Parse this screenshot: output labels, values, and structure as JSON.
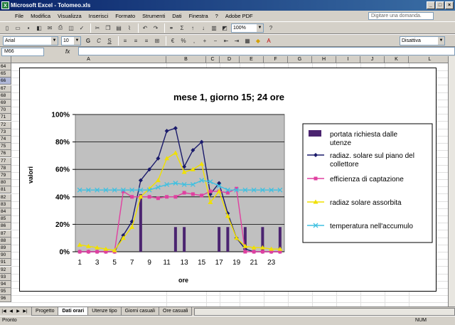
{
  "window": {
    "title": "Microsoft Excel - Tolomeo.xls",
    "app_icon": "X"
  },
  "menu": [
    "File",
    "Modifica",
    "Visualizza",
    "Inserisci",
    "Formato",
    "Strumenti",
    "Dati",
    "Finestra",
    "?",
    "Adobe PDF"
  ],
  "ask_placeholder": "Digitare una domanda.",
  "toolbar": {
    "zoom": "100%",
    "font": "Arial",
    "size": "10",
    "style": "Disattiva"
  },
  "formula": {
    "namebox": "M66",
    "fx": "fx"
  },
  "columns": [
    "A",
    "B",
    "C",
    "D",
    "E",
    "F",
    "G",
    "H",
    "I",
    "J",
    "K",
    "L"
  ],
  "rows": [
    "64",
    "65",
    "66",
    "67",
    "68",
    "69",
    "70",
    "71",
    "72",
    "73",
    "74",
    "75",
    "76",
    "77",
    "78",
    "79",
    "80",
    "81",
    "82",
    "83",
    "84",
    "85",
    "86",
    "87",
    "88",
    "89",
    "90",
    "91",
    "92",
    "93",
    "94",
    "95",
    "96"
  ],
  "selected_row": "66",
  "sheets": [
    "Progetto",
    "Dati orari",
    "Utenze tipo",
    "Giorni casuali",
    "Ore casuali"
  ],
  "active_sheet": 1,
  "status": {
    "left": "Pronto",
    "right": "NUM"
  },
  "chart_data": {
    "type": "line",
    "title": "mese 1, giorno 15; 24 ore",
    "xlabel": "ore",
    "ylabel": "valori",
    "x": [
      1,
      2,
      3,
      4,
      5,
      6,
      7,
      8,
      9,
      10,
      11,
      12,
      13,
      14,
      15,
      16,
      17,
      18,
      19,
      20,
      21,
      22,
      23,
      24
    ],
    "x_tick_labels": [
      "1",
      "3",
      "5",
      "7",
      "9",
      "11",
      "13",
      "15",
      "17",
      "19",
      "21",
      "23"
    ],
    "y_tick_labels": [
      "0%",
      "20%",
      "40%",
      "60%",
      "80%",
      "100%"
    ],
    "ylim": [
      0,
      100
    ],
    "series": [
      {
        "name": "portata richiesta dalle utenze",
        "kind": "bar",
        "color": "#4b2470",
        "values": [
          0,
          0,
          0,
          0,
          0,
          0,
          0,
          42,
          0,
          0,
          0,
          18,
          18,
          0,
          0,
          0,
          18,
          18,
          0,
          18,
          0,
          18,
          0,
          18
        ]
      },
      {
        "name": "radiaz. solare sul piano del collettore",
        "kind": "line",
        "color": "#1a1a6b",
        "marker": "diamond",
        "values": [
          0,
          0,
          0,
          0,
          0,
          12,
          22,
          52,
          60,
          68,
          88,
          90,
          62,
          74,
          80,
          42,
          50,
          28,
          10,
          2,
          0,
          0,
          0,
          0
        ]
      },
      {
        "name": "efficienza di captazione",
        "kind": "line",
        "color": "#e040a0",
        "marker": "square",
        "values": [
          0,
          0,
          0,
          0,
          0,
          44,
          40,
          40,
          40,
          39,
          40,
          40,
          43,
          42,
          41,
          44,
          44,
          43,
          46,
          0,
          0,
          0,
          0,
          0
        ]
      },
      {
        "name": "radiaz solare assorbita",
        "kind": "line",
        "color": "#f0e000",
        "marker": "triangle",
        "values": [
          5,
          4,
          3,
          2,
          1,
          10,
          18,
          40,
          46,
          52,
          68,
          72,
          58,
          60,
          64,
          36,
          44,
          26,
          10,
          4,
          3,
          3,
          2,
          2
        ]
      },
      {
        "name": "temperatura nell'accumulo",
        "kind": "line",
        "color": "#40c0e0",
        "marker": "x",
        "values": [
          45,
          45,
          45,
          45,
          45,
          45,
          45,
          45,
          45,
          47,
          49,
          50,
          49,
          49,
          52,
          51,
          48,
          45,
          45,
          45,
          45,
          45,
          45,
          45
        ]
      }
    ],
    "legend": "right",
    "grid": true
  }
}
